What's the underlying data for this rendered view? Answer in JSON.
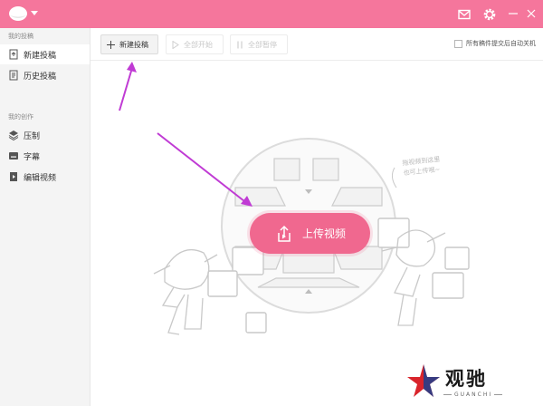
{
  "sidebar": {
    "section1": "我的投稿",
    "items1": [
      {
        "label": "新建投稿",
        "icon": "upload-doc-icon"
      },
      {
        "label": "历史投稿",
        "icon": "history-doc-icon"
      }
    ],
    "section2": "我的创作",
    "items2": [
      {
        "label": "压制",
        "icon": "layers-icon"
      },
      {
        "label": "字幕",
        "icon": "subtitle-icon"
      },
      {
        "label": "编辑视频",
        "icon": "edit-video-icon"
      }
    ]
  },
  "toolbar": {
    "new_label": "新建投稿",
    "start_all_label": "全部开始",
    "pause_all_label": "全部暂停",
    "auto_shutdown_label": "所有稿件提交后自动关机"
  },
  "main": {
    "upload_label": "上传视频",
    "drag_hint": "拖视频到这里\n也可上传哦~"
  },
  "watermark": {
    "text": "观驰",
    "sub": "GUANCHI"
  },
  "colors": {
    "accent": "#f5769c",
    "upload": "#f0688f",
    "arrow": "#c03bd4"
  }
}
